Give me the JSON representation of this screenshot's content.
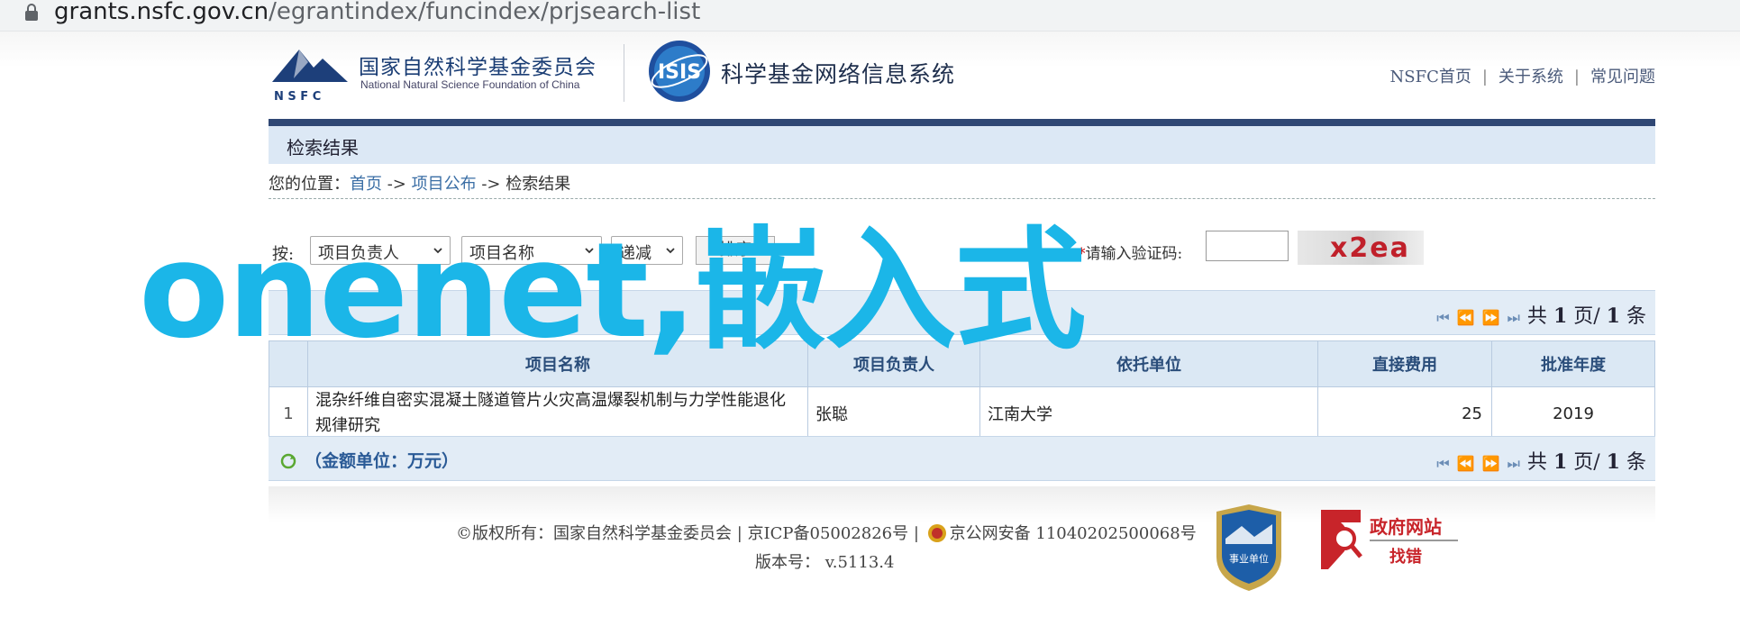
{
  "browser": {
    "url_host": "grants.nsfc.gov.cn",
    "url_path": "/egrantindex/funcindex/prjsearch-list"
  },
  "header": {
    "org_cn": "国家自然科学基金委员会",
    "org_en": "National Natural Science Foundation of China",
    "logo_letters": "N S F C",
    "isis_logo_text": "ISIS",
    "system_title": "科学基金网络信息系统",
    "nav": [
      "NSFC首页",
      "关于系统",
      "常见问题"
    ],
    "nav_separator": "|"
  },
  "page_title": "检索结果",
  "breadcrumb": {
    "prefix": "您的位置：",
    "items": [
      "首页",
      "项目公布",
      "检索结果"
    ],
    "sep": " -> "
  },
  "sort": {
    "label": "按:",
    "selects": [
      "项目负责人",
      "项目名称",
      "递减"
    ],
    "button": "排序"
  },
  "captcha": {
    "required_mark": "*",
    "label": "请输入验证码:",
    "value": "",
    "image_text": "x2ea"
  },
  "pager": {
    "prefix": "共",
    "current": "1",
    "page_label": "页/",
    "total": "1",
    "suffix": "条"
  },
  "table": {
    "headers": [
      "",
      "项目名称",
      "项目负责人",
      "依托单位",
      "直接费用",
      "批准年度"
    ],
    "rows": [
      {
        "index": "1",
        "name": "混杂纤维自密实混凝土隧道管片火灾高温爆裂机制与力学性能退化规律研究",
        "leader": "张聪",
        "institution": "江南大学",
        "cost": "25",
        "year": "2019"
      }
    ]
  },
  "amount_unit": "（金额单位：万元）",
  "footer": {
    "copyright": "©版权所有：国家自然科学基金委员会 | 京ICP备05002826号 |",
    "police": "京公网安备 11040202500068号",
    "version": "版本号：  v.5113.4",
    "shiye_label": "事业单位",
    "gov_title": "政府网站",
    "gov_sub": "找错"
  },
  "overlay_text": "onenet,嵌入式",
  "colors": {
    "brand_navy": "#2f4774",
    "header_blue": "#dbe8f4",
    "overlay_cyan": "#1bb6e8",
    "captcha_red": "#c0202a"
  }
}
